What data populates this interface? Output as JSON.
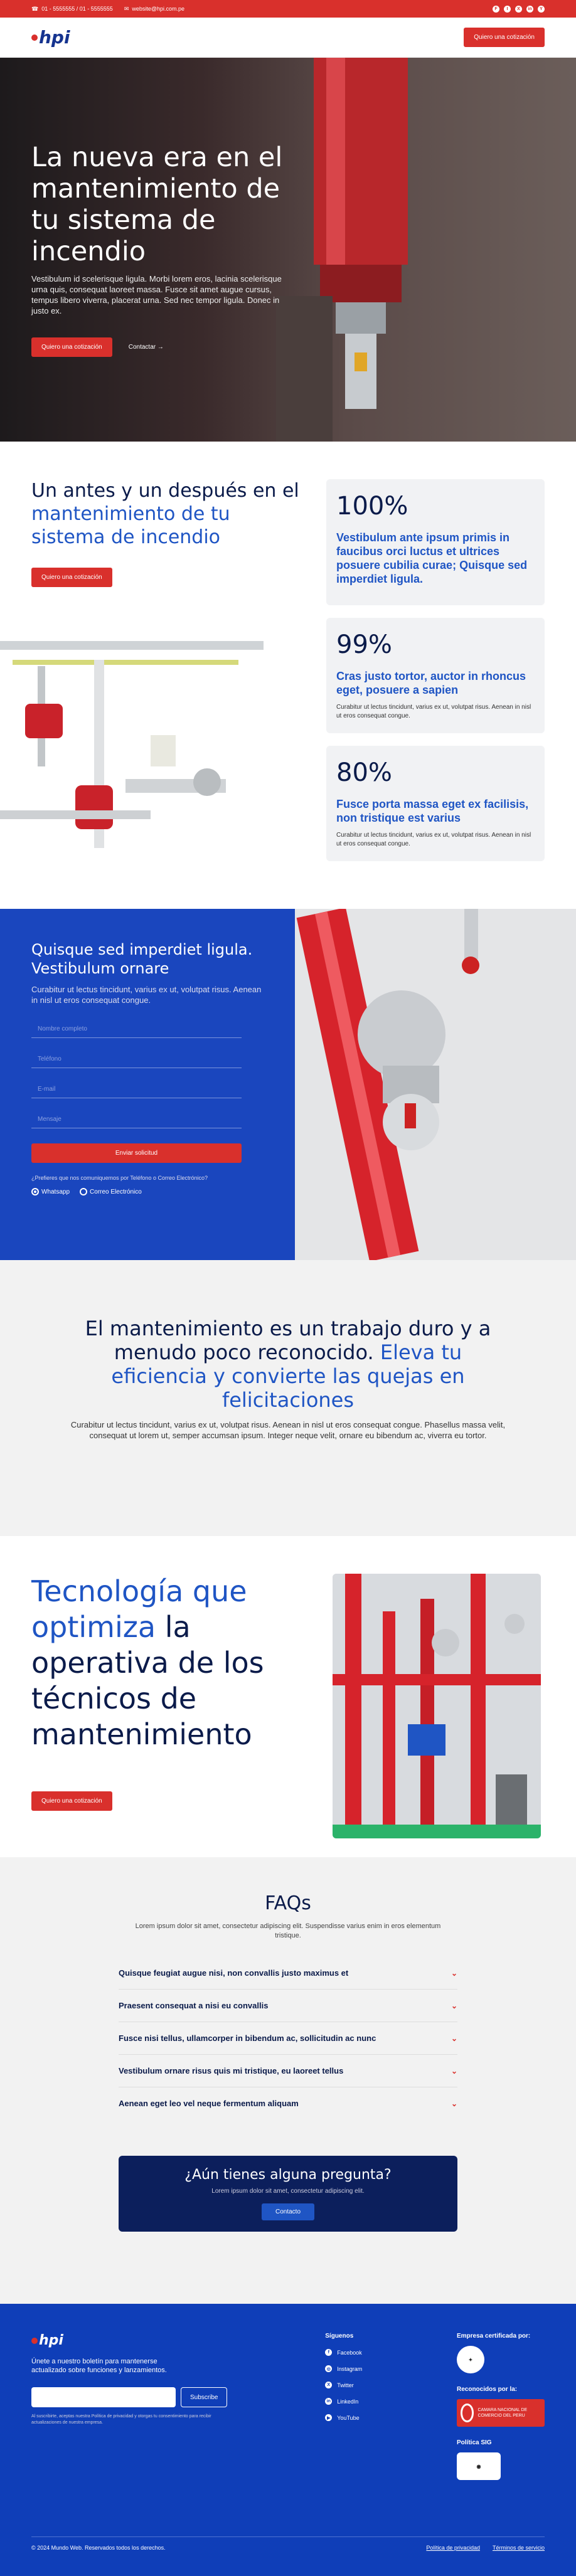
{
  "topbar": {
    "phone": "01 - 5555555 / 01 - 5555555",
    "email": "website@hpi.com.pe",
    "social": [
      "F",
      "I",
      "X",
      "in",
      "Y"
    ]
  },
  "nav": {
    "logo": "hpi",
    "cta": "Quiero una cotización"
  },
  "hero": {
    "title": "La nueva era en el mantenimiento de tu sistema de incendio",
    "text": "Vestibulum id scelerisque ligula. Morbi lorem eros, lacinia scelerisque urna quis, consequat laoreet massa. Fusce sit amet augue cursus, tempus libero viverra, placerat urna. Sed nec tempor ligula. Donec in justo ex.",
    "cta": "Quiero una cotización",
    "link": "Contactar →"
  },
  "beforeafter": {
    "title_a": "Un antes y un después en el ",
    "title_b": "mantenimiento de tu sistema de incendio",
    "cta": "Quiero una cotización",
    "stats": [
      {
        "number": "100%",
        "heading": "Vestibulum ante ipsum primis in faucibus orci luctus et ultrices posuere cubilia curae; Quisque sed imperdiet ligula.",
        "desc": ""
      },
      {
        "number": "99%",
        "heading": "Cras justo tortor, auctor in rhoncus eget, posuere a sapien",
        "desc": "Curabitur ut lectus tincidunt, varius ex ut, volutpat risus. Aenean in nisl ut eros consequat congue."
      },
      {
        "number": "80%",
        "heading": "Fusce porta massa eget ex facilisis, non tristique est varius",
        "desc": "Curabitur ut lectus tincidunt, varius ex ut, volutpat risus. Aenean in nisl ut eros consequat congue."
      }
    ]
  },
  "form": {
    "title": "Quisque sed imperdiet ligula. Vestibulum ornare",
    "subtitle": "Curabitur ut lectus tincidunt, varius ex ut, volutpat risus. Aenean in nisl ut eros consequat congue.",
    "fields": {
      "name": "Nombre completo",
      "phone": "Teléfono",
      "email": "E-mail",
      "message": "Mensaje"
    },
    "submit": "Enviar solicitud",
    "pref": "¿Prefieres que nos comuniquemos por Teléfono o Correo Electrónico?",
    "opt1": "Whatsapp",
    "opt2": "Correo Electrónico"
  },
  "maint": {
    "title_a": "El mantenimiento es un trabajo duro y a menudo poco reconocido. ",
    "title_b": "Eleva tu eficiencia y convierte las quejas en felicitaciones",
    "text": "Curabitur ut lectus tincidunt, varius ex ut, volutpat risus. Aenean in nisl ut eros consequat congue. Phasellus massa velit, consequat ut lorem ut, semper accumsan ipsum. Integer neque velit, ornare eu bibendum ac, viverra eu tortor."
  },
  "tech": {
    "title_a": "Tecnología que optimiza",
    "title_b": " la operativa de los técnicos de mantenimiento",
    "cta": "Quiero una cotización"
  },
  "faq": {
    "title": "FAQs",
    "subtitle": "Lorem ipsum dolor sit amet, consectetur adipiscing elit. Suspendisse varius enim in eros elementum tristique.",
    "items": [
      "Quisque feugiat augue nisi, non convallis justo maximus et",
      "Praesent consequat a nisi eu convallis",
      "Fusce nisi tellus, ullamcorper in bibendum ac, sollicitudin ac nunc",
      "Vestibulum ornare risus quis mi tristique, eu laoreet tellus",
      "Aenean eget leo vel neque fermentum aliquam"
    ],
    "cta_title": "¿Aún tienes alguna pregunta?",
    "cta_text": "Lorem ipsum dolor sit amet, consectetur adipiscing elit.",
    "cta_button": "Contacto"
  },
  "footer": {
    "logo": "hpi",
    "text": "Únete a nuestro boletín para mantenerse actualizado sobre funciones y lanzamientos.",
    "email_ph": "",
    "subscribe": "Subscribe",
    "tiny": "Al suscribirte, aceptas nuestra Política de privacidad y otorgas tu consentimiento para recibir actualizaciones de nuestra empresa.",
    "follow": "Síguenos",
    "social": [
      {
        "icon": "f",
        "label": "Facebook"
      },
      {
        "icon": "◎",
        "label": "Instagram"
      },
      {
        "icon": "X",
        "label": "Twitter"
      },
      {
        "icon": "in",
        "label": "LinkedIn"
      },
      {
        "icon": "▶",
        "label": "YouTube"
      }
    ],
    "cert_title": "Empresa certificada por:",
    "recog_title": "Reconocidos por la:",
    "recog_text": "CAMARA NACIONAL DE COMERCIO DEL PERU",
    "policy_title": "Política SIG",
    "copyright": "© 2024 Mundo Web. Reservados todos los derechos.",
    "privacy": "Política de privacidad",
    "terms": "Términos de servicio"
  }
}
